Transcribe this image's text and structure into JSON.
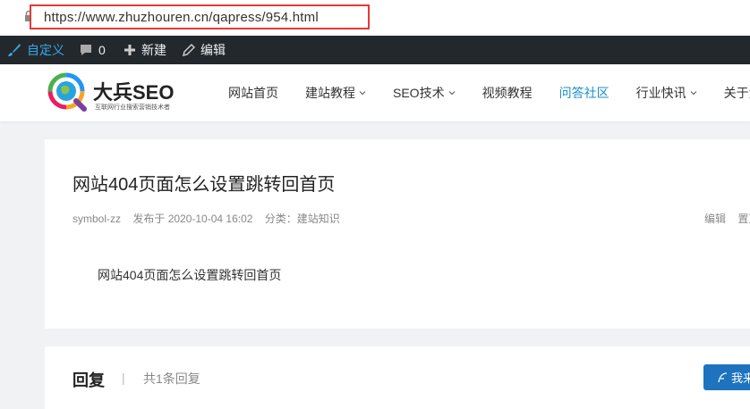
{
  "browser": {
    "url": "https://www.zhuzhouren.cn/qapress/954.html"
  },
  "adminbar": {
    "customize": "自定义",
    "comments_count": "0",
    "new": "新建",
    "edit": "编辑"
  },
  "site": {
    "brand": "大兵SEO",
    "tagline": "互联网行业搜索营销技术者",
    "nav": [
      {
        "label": "网站首页"
      },
      {
        "label": "建站教程"
      },
      {
        "label": "SEO技术"
      },
      {
        "label": "视频教程"
      },
      {
        "label": "问答社区"
      },
      {
        "label": "行业快讯"
      },
      {
        "label": "关于大"
      }
    ]
  },
  "post": {
    "title": "网站404页面怎么设置跳转回首页",
    "author": "symbol-zz",
    "published": "发布于 2020-10-04 16:02",
    "category": "分类：建站知识",
    "edit": "编辑",
    "pin": "置顶",
    "content": "网站404页面怎么设置跳转回首页"
  },
  "replies": {
    "title": "回复",
    "separator": "|",
    "count": "共1条回复",
    "button": "我来"
  },
  "colors": {
    "accent": "#1b8fc7",
    "adminbar": "#23282d",
    "highlight": "#e53935"
  }
}
